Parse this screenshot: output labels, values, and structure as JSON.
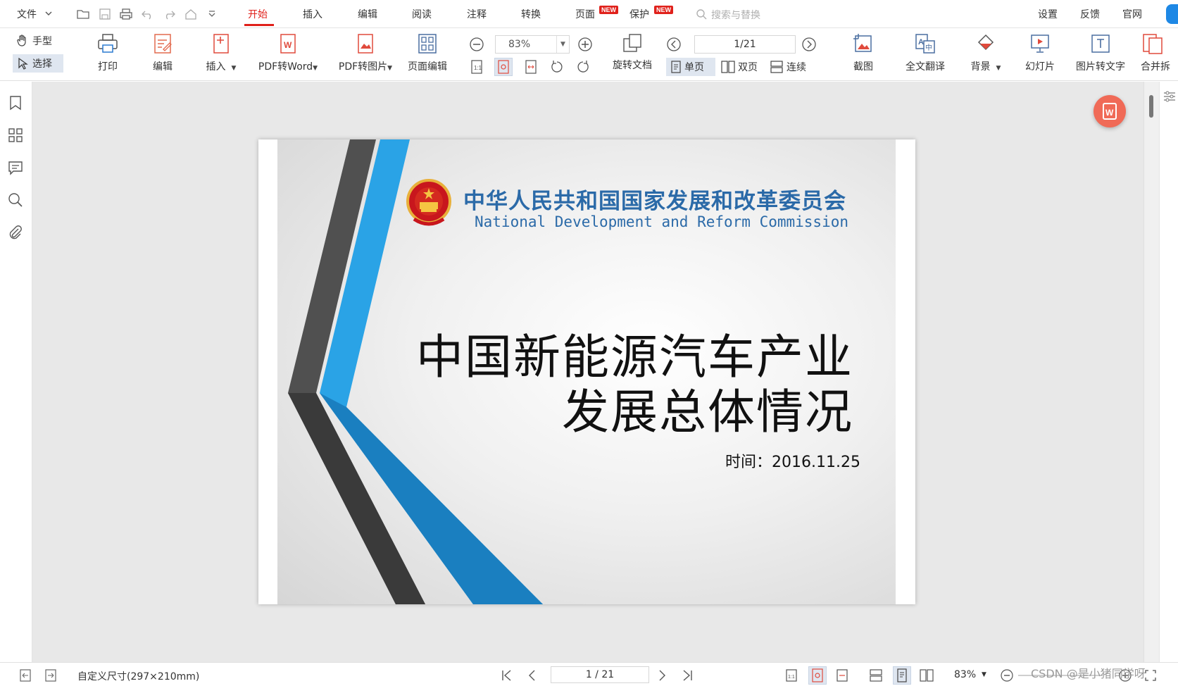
{
  "menubar": {
    "file": "文件",
    "tabs": [
      {
        "label": "开始",
        "active": true
      },
      {
        "label": "插入"
      },
      {
        "label": "编辑"
      },
      {
        "label": "阅读"
      },
      {
        "label": "注释"
      },
      {
        "label": "转换"
      },
      {
        "label": "页面",
        "badge": "NEW"
      },
      {
        "label": "保护",
        "badge": "NEW"
      }
    ],
    "search_placeholder": "搜索与替换",
    "right": [
      "设置",
      "反馈",
      "官网"
    ]
  },
  "ribbon": {
    "hand": "手型",
    "select": "选择",
    "print": "打印",
    "edit": "编辑",
    "insert": "插入",
    "pdf_to_word": "PDF转Word",
    "pdf_to_image": "PDF转图片",
    "page_edit": "页面编辑",
    "zoom": "83%",
    "rotate_doc": "旋转文档",
    "page_num": "1/21",
    "single": "单页",
    "double": "双页",
    "continuous": "连续",
    "screenshot": "截图",
    "translate": "全文翻译",
    "background": "背景",
    "slideshow": "幻灯片",
    "ocr": "图片转文字",
    "merge": "合并拆"
  },
  "slide": {
    "org_cn": "中华人民共和国国家发展和改革委员会",
    "org_en": "National Development and Reform Commission",
    "title_line1": "中国新能源汽车产业",
    "title_line2": "发展总体情况",
    "date": "时间：2016.11.25"
  },
  "status": {
    "page_size": "自定义尺寸(297×210mm)",
    "page_num": "1 / 21",
    "zoom": "83%",
    "watermark": "CSDN @是小猪同学呀"
  },
  "colors": {
    "accent": "#e0211b",
    "slide_blue": "#2b6aa8",
    "stripe_blue": "#1e9be0",
    "stripe_gray": "#555555"
  }
}
